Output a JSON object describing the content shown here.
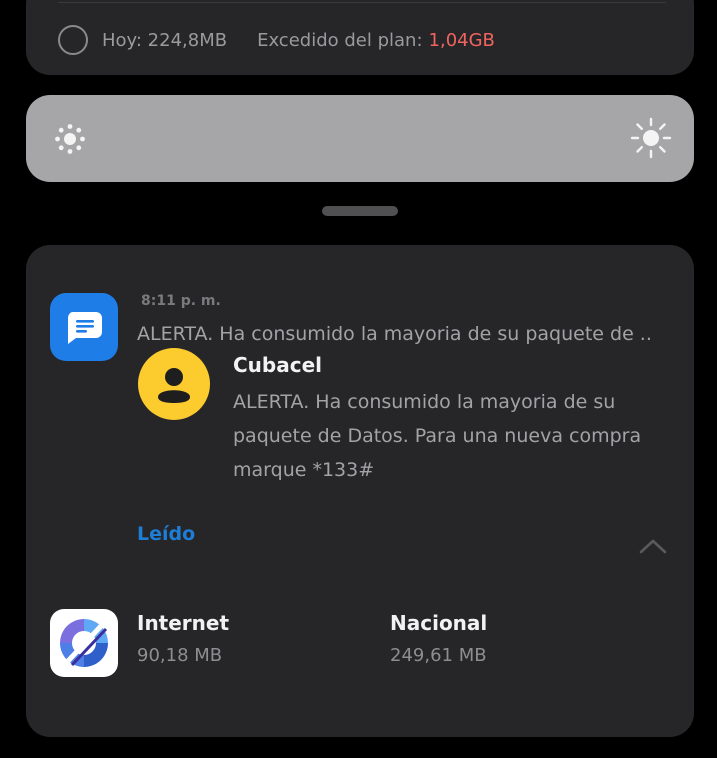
{
  "usage": {
    "today_label": "Hoy: 224,8MB",
    "excess_label": "Excedido del plan:",
    "excess_value": "1,04GB",
    "excess_color": "#f0645f"
  },
  "brightness": {
    "low_icon": "brightness-low-icon",
    "high_icon": "brightness-high-icon"
  },
  "notification": {
    "app_icon": "messages-app-icon",
    "time": "8:11 p. m.",
    "preview": "ALERTA. Ha consumido la mayoria de su paquete de ..",
    "sender": "Cubacel",
    "message": "ALERTA. Ha consumido la mayoria de su paquete de Datos. Para una nueva compra marque *133#",
    "action_label": "Leído",
    "accent_color": "#1c7ed6",
    "collapse_icon": "chevron-up-icon"
  },
  "data_usage": {
    "app_icon": "data-monitor-app-icon",
    "internet_label": "Internet",
    "internet_value": "90,18 MB",
    "national_label": "Nacional",
    "national_value": "249,61 MB"
  }
}
